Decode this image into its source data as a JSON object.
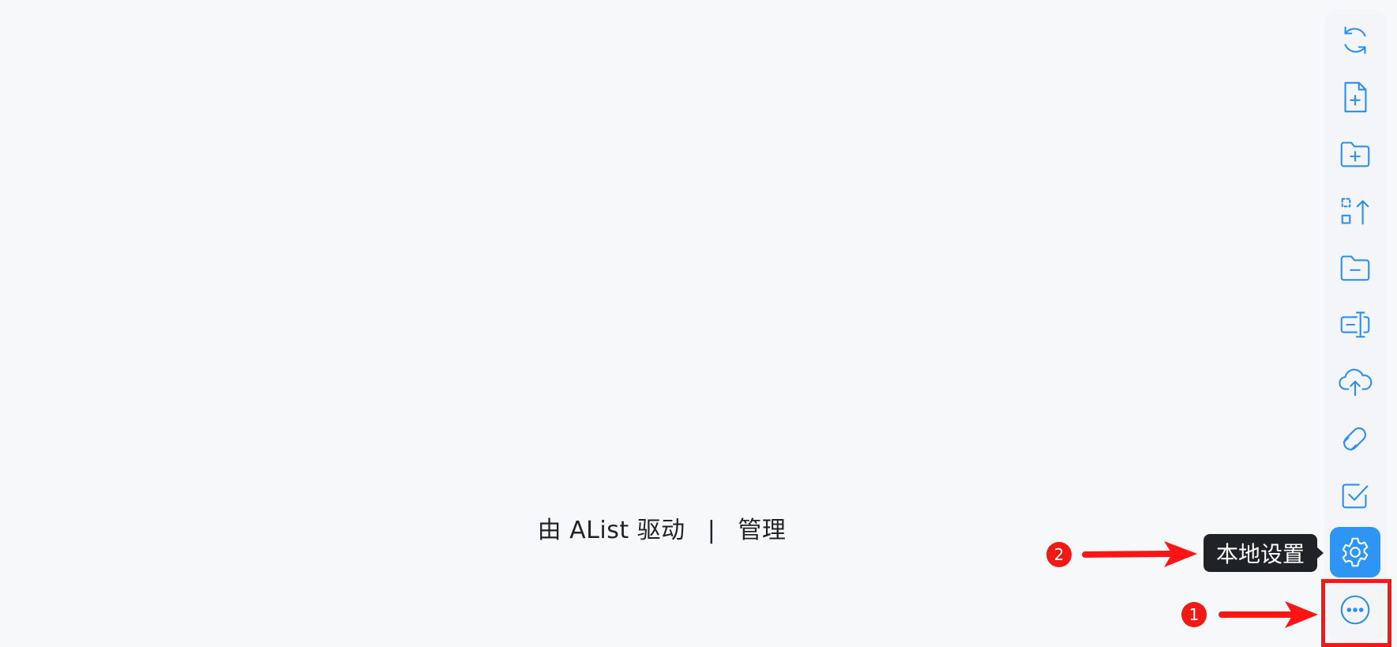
{
  "footer": {
    "powered_by": "由 AList 驱动",
    "separator": "|",
    "manage_link": "管理"
  },
  "toolbar": {
    "items": [
      {
        "name": "refresh",
        "icon": "refresh-icon"
      },
      {
        "name": "new-file",
        "icon": "file-plus-icon"
      },
      {
        "name": "new-folder",
        "icon": "folder-plus-icon"
      },
      {
        "name": "upload-arrange",
        "icon": "select-upload-icon"
      },
      {
        "name": "remove-folder",
        "icon": "folder-minus-icon"
      },
      {
        "name": "rename",
        "icon": "rename-icon"
      },
      {
        "name": "upload",
        "icon": "cloud-upload-icon"
      },
      {
        "name": "offline-download",
        "icon": "magnet-icon"
      },
      {
        "name": "select",
        "icon": "checkbox-icon"
      },
      {
        "name": "local-settings",
        "icon": "gear-icon",
        "active": true
      },
      {
        "name": "more",
        "icon": "more-icon"
      }
    ]
  },
  "tooltip": {
    "text": "本地设置"
  },
  "annotations": {
    "step1": "1",
    "step2": "2",
    "color": "#ff1414"
  },
  "colors": {
    "accent": "#2b8fee",
    "active_bg": "#2f95f4",
    "background": "#f7f8fa",
    "tooltip_bg": "#1f2226"
  }
}
